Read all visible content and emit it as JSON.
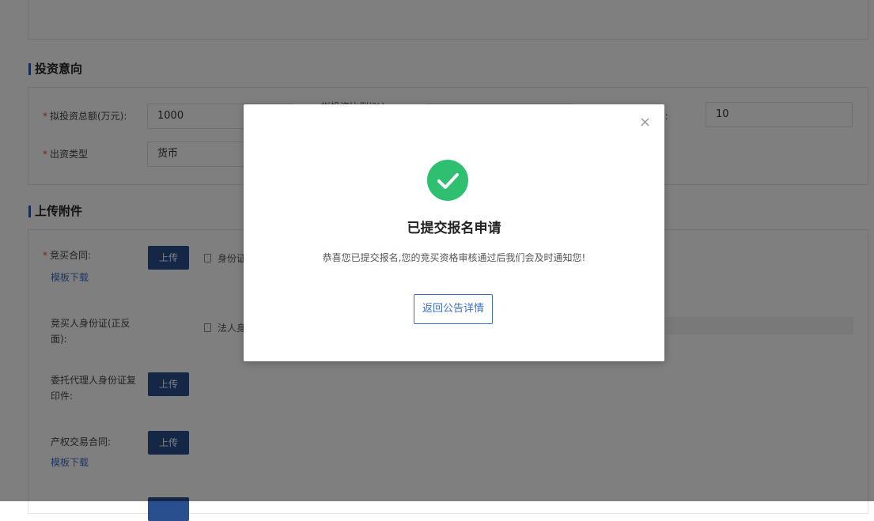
{
  "invest_section": {
    "title": "投资意向",
    "total_label": "拟投资总额(万元):",
    "total_value": "1000",
    "middle_label_partial": "拟投资比例(%)",
    "right_label_partial": "):",
    "right_value": "10",
    "type_label": "出资类型",
    "type_value": "货币",
    "required_mark": "*"
  },
  "upload_section": {
    "title": "上传附件",
    "upload_label": "上传",
    "template_link": "模板下载",
    "items": [
      {
        "label": "竞买合同:",
        "file": "身份证"
      },
      {
        "label": "竞买人身份证(正反面):",
        "file": "法人身"
      },
      {
        "label": "委托代理人身份证复印件:"
      },
      {
        "label": "产权交易合同:"
      }
    ]
  },
  "modal": {
    "title": "已提交报名申请",
    "message": "恭喜您已提交报名,您的竞买资格审核通过后我们会及时通知您!",
    "button": "返回公告详情",
    "close_icon": "×",
    "success_color": "#2fbf71"
  }
}
